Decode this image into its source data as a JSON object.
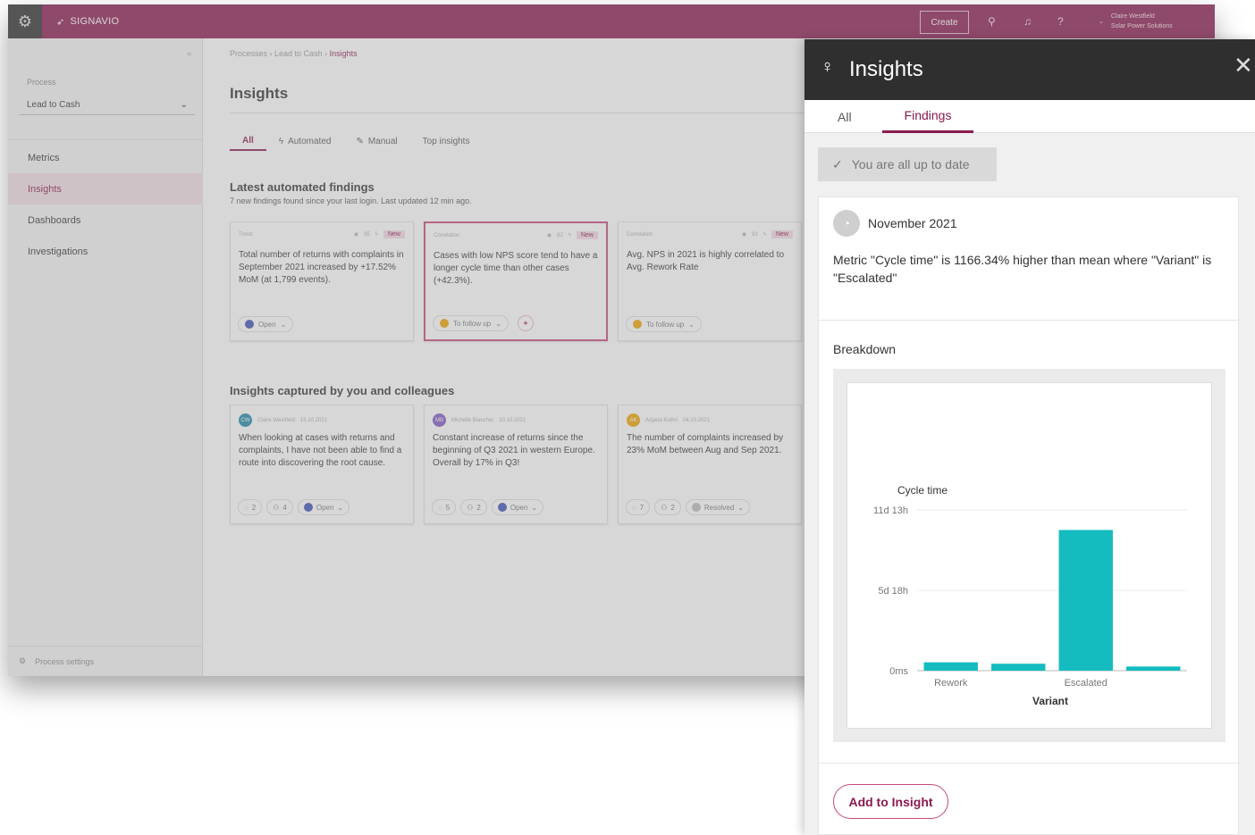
{
  "topbar": {
    "brand": "SIGNAVIO",
    "create_label": "Create",
    "user_name": "Claire Westfield",
    "user_org": "Solar Power Solutions"
  },
  "sidebar": {
    "process_label": "Process",
    "process_value": "Lead to Cash",
    "items": [
      {
        "label": "Metrics"
      },
      {
        "label": "Insights"
      },
      {
        "label": "Dashboards"
      },
      {
        "label": "Investigations"
      }
    ],
    "settings_label": "Process settings"
  },
  "main": {
    "breadcrumb": [
      "Processes",
      "Lead to Cash",
      "Insights"
    ],
    "title": "Insights",
    "tabs": [
      {
        "label": "All"
      },
      {
        "label": "Automated"
      },
      {
        "label": "Manual"
      },
      {
        "label": "Top insights"
      }
    ],
    "latest_title": "Latest automated findings",
    "latest_sub": "7 new findings found since your last login. Last updated 12 min ago.",
    "findings": [
      {
        "type": "Trend",
        "views": "95",
        "badge": "New",
        "text": "Total number of returns with complaints in September 2021 increased by +17.52% MoM (at 1,799 events).",
        "status": "Open",
        "status_color": "#3f51b5"
      },
      {
        "type": "Correlation",
        "views": "82",
        "badge": "New",
        "text": "Cases with low NPS score tend to have a longer cycle time than other cases (+42.3%).",
        "status": "To follow up",
        "status_color": "#f0a500"
      },
      {
        "type": "Correlation",
        "views": "91",
        "badge": "New",
        "text": "Avg. NPS in 2021 is highly correlated to Avg. Rework Rate",
        "status": "To follow up",
        "status_color": "#f0a500"
      }
    ],
    "captured_title": "Insights captured by you and colleagues",
    "captured": [
      {
        "initials": "CW",
        "avatar_color": "#1e88a8",
        "author": "Claire Westfield",
        "date": "15.10.2021",
        "text": "When looking at cases with returns and complaints, I have not been able to find a route into discovering the root cause.",
        "comments": "2",
        "people": "4",
        "status": "Open",
        "status_color": "#3f51b5"
      },
      {
        "initials": "MB",
        "avatar_color": "#7e57c2",
        "author": "Michelle Blancher",
        "date": "20.10.2021",
        "text": "Constant increase of returns since the beginning of Q3 2021 in western Europe. Overall by 17% in Q3!",
        "comments": "5",
        "people": "2",
        "status": "Open",
        "status_color": "#3f51b5"
      },
      {
        "initials": "AK",
        "avatar_color": "#f0a500",
        "author": "Anjana Kothri",
        "date": "04.10.2021",
        "text": "The number of complaints increased by 23% MoM between Aug and Sep 2021.",
        "comments": "7",
        "people": "2",
        "status": "Resolved",
        "status_color": "#bdbdbd"
      }
    ]
  },
  "panel": {
    "title": "Insights",
    "tabs": [
      {
        "label": "All"
      },
      {
        "label": "Findings"
      }
    ],
    "uptodate": "You are all up to date",
    "finding_date": "November 2021",
    "finding_text": "Metric \"Cycle time\" is 1166.34% higher than mean where \"Variant\" is \"Escalated\"",
    "breakdown_label": "Breakdown",
    "add_button": "Add to Insight"
  },
  "chart_data": {
    "type": "bar",
    "title": "",
    "ylabel": "Cycle time",
    "xlabel": "Variant",
    "categories": [
      "Rework",
      "",
      "Escalated",
      ""
    ],
    "x_tick_labels": [
      "Rework",
      "Escalated"
    ],
    "values_days": [
      0.6,
      0.5,
      10.1,
      0.3
    ],
    "ylim_days": [
      0,
      11.54
    ],
    "y_ticks": [
      {
        "value_days": 0,
        "label": "0ms"
      },
      {
        "value_days": 5.77,
        "label": "5d 18h"
      },
      {
        "value_days": 11.54,
        "label": "11d 13h"
      }
    ],
    "color": "#14bcc0",
    "grid": true
  }
}
